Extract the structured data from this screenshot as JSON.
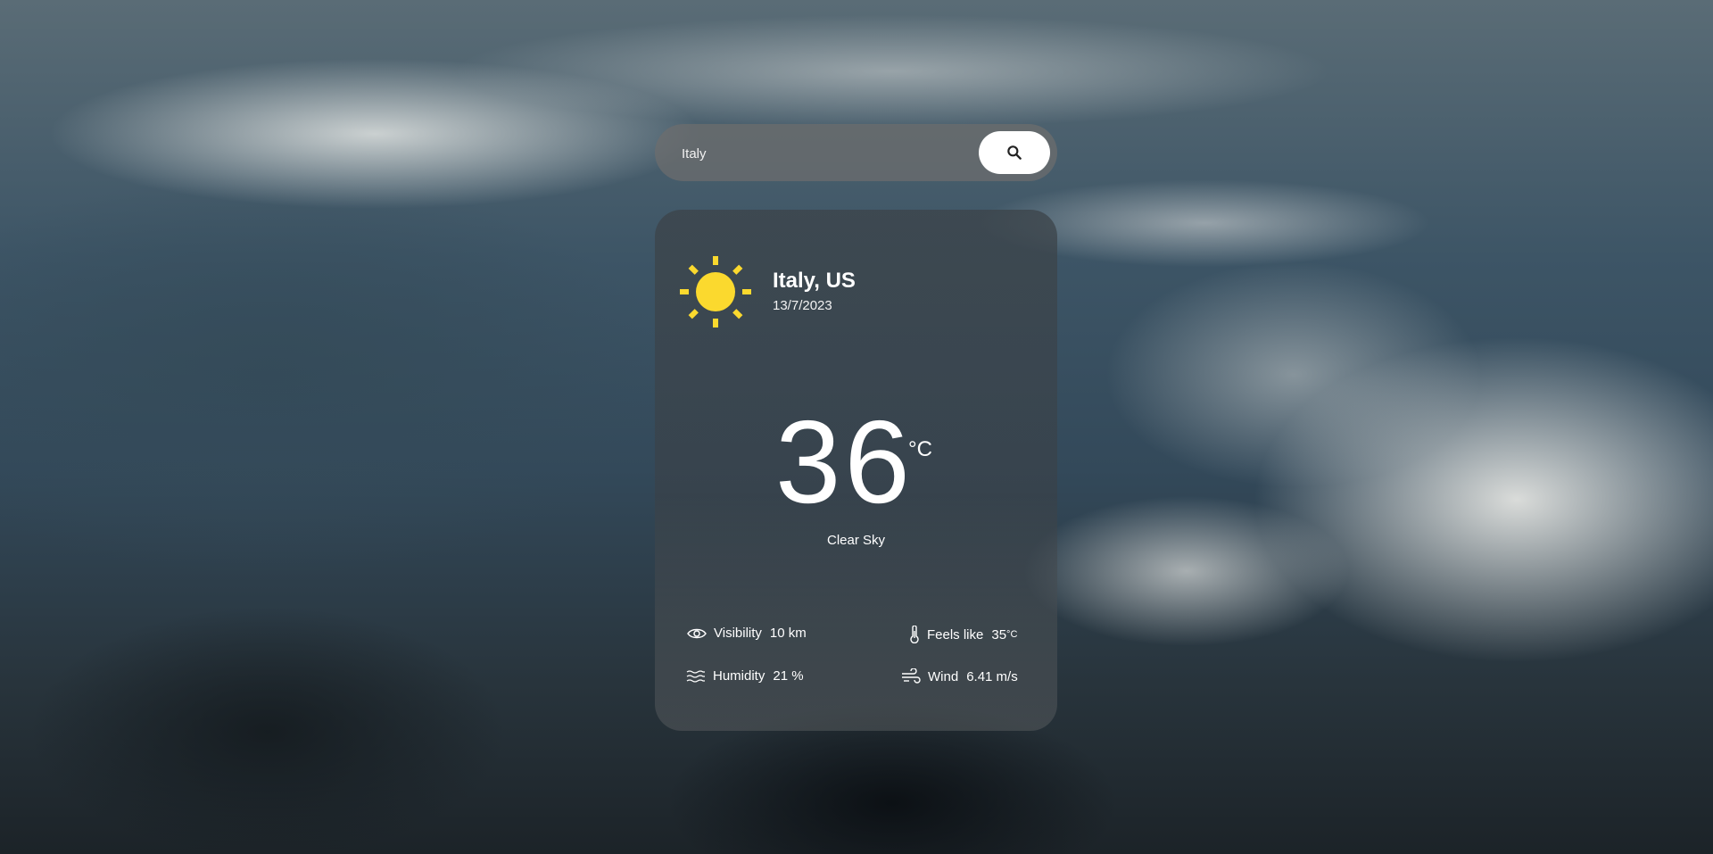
{
  "search": {
    "value": "Italy",
    "placeholder": ""
  },
  "weather": {
    "icon": "sun-icon",
    "location": "Italy, US",
    "date": "13/7/2023",
    "temperature": "36",
    "temperature_unit": "°C",
    "condition": "Clear Sky",
    "visibility_label": "Visibility",
    "visibility_value": "10 km",
    "humidity_label": "Humidity",
    "humidity_value": "21 %",
    "feels_like_label": "Feels like",
    "feels_like_value": "35",
    "feels_like_unit": "°C",
    "wind_label": "Wind",
    "wind_value": "6.41 m/s"
  },
  "colors": {
    "sun": "#fbd92e",
    "button_bg": "#ffffff",
    "text": "#ffffff"
  }
}
